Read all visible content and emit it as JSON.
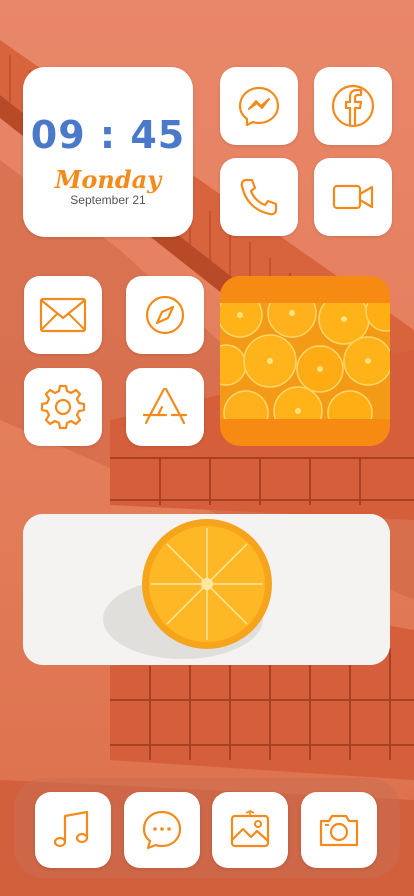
{
  "theme": {
    "icon_color": "#f38b1c",
    "time_color": "#4a79c9",
    "day_color": "#f38b1c"
  },
  "clock_widget": {
    "time": "09 : 45",
    "day": "Monday",
    "date": "September 21"
  },
  "apps": [
    {
      "name": "messenger",
      "icon": "messenger-icon"
    },
    {
      "name": "facebook",
      "icon": "facebook-icon"
    },
    {
      "name": "phone",
      "icon": "phone-icon"
    },
    {
      "name": "facetime",
      "icon": "video-camera-icon"
    },
    {
      "name": "mail",
      "icon": "mail-icon"
    },
    {
      "name": "safari",
      "icon": "compass-icon"
    },
    {
      "name": "settings",
      "icon": "gear-icon"
    },
    {
      "name": "app store",
      "icon": "app-store-icon"
    }
  ],
  "dock": [
    {
      "name": "music",
      "icon": "music-note-icon"
    },
    {
      "name": "messages",
      "icon": "chat-bubble-icon"
    },
    {
      "name": "photos",
      "icon": "photo-icon"
    },
    {
      "name": "camera",
      "icon": "camera-icon"
    }
  ]
}
